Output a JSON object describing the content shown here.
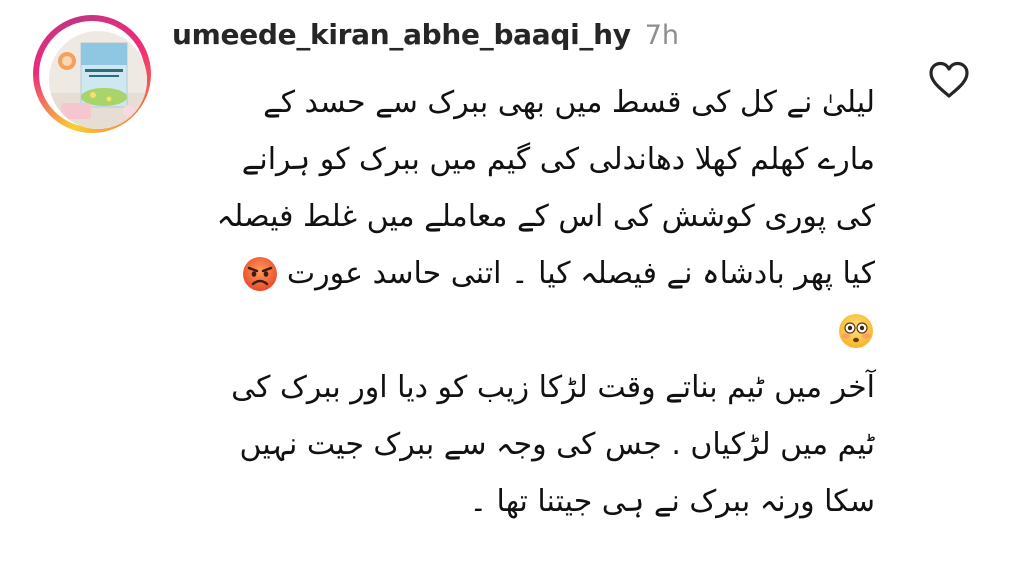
{
  "comment": {
    "username": "umeede_kiran_abhe_baaqi_hy",
    "timestamp": "7h",
    "avatar_icon": "book-cover-avatar",
    "like_icon": "heart-outline-icon",
    "lines": [
      "لیلیٰ نے کل کی قسط میں بھی ببرک سے حسد کے",
      "مارے کھلم کھلا دھاندلی کی گیم میں ببرک  کو ہرانے",
      "کی پوری کوشش کی اس کے معاملے میں غلط فیصلہ",
      "کیا پھر بادشاہ نے فیصلہ کیا ۔ اتنی حاسد عورت",
      "",
      "آخر میں ٹیم بناتے وقت لڑکا زیب کو دیا اور ببرک کی",
      "ٹیم میں لڑکیاں . جس کی وجہ سے ببرک جیت نہیں",
      "سکا ورنہ ببرک نے ہی جیتنا تھا ۔"
    ],
    "emojis": {
      "angry": "angry-face-emoji",
      "flushed": "flushed-face-emoji"
    }
  }
}
